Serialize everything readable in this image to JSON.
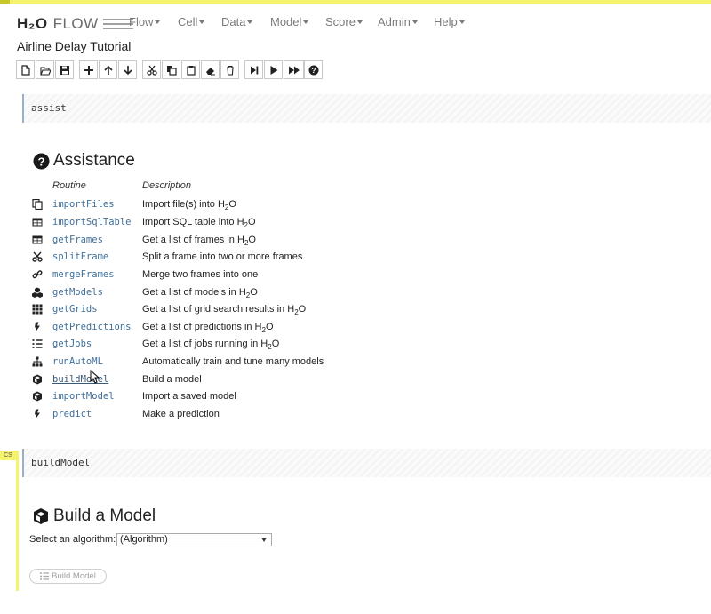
{
  "app": {
    "logo_text": "H₂O",
    "logo_flow": "FLOW",
    "menu": [
      "Flow",
      "Cell",
      "Data",
      "Model",
      "Score",
      "Admin",
      "Help"
    ],
    "notebook_title": "Airline Delay Tutorial"
  },
  "toolbar": {
    "buttons": [
      "new-file-icon",
      "open-folder-icon",
      "save-icon",
      "add-cell-icon",
      "move-up-icon",
      "move-down-icon",
      "cut-icon",
      "copy-icon",
      "paste-icon",
      "clear-output-icon",
      "delete-icon",
      "run-to-cursor-icon",
      "run-icon",
      "run-all-icon",
      "help-icon"
    ]
  },
  "cell1": {
    "input": "assist",
    "heading": "Assistance",
    "col_routine": "Routine",
    "col_description": "Description",
    "routines": [
      {
        "icon": "files-icon",
        "name": "importFiles",
        "desc_pre": "Import file(s) into H",
        "desc_sub": "2",
        "desc_post": "O"
      },
      {
        "icon": "table-icon",
        "name": "importSqlTable",
        "desc_pre": "Import SQL table into H",
        "desc_sub": "2",
        "desc_post": "O"
      },
      {
        "icon": "table-icon",
        "name": "getFrames",
        "desc_pre": "Get a list of frames in H",
        "desc_sub": "2",
        "desc_post": "O"
      },
      {
        "icon": "scissors-icon",
        "name": "splitFrame",
        "desc_pre": "Split a frame into two or more frames",
        "desc_sub": "",
        "desc_post": ""
      },
      {
        "icon": "link-icon",
        "name": "mergeFrames",
        "desc_pre": "Merge two frames into one",
        "desc_sub": "",
        "desc_post": ""
      },
      {
        "icon": "cubes-icon",
        "name": "getModels",
        "desc_pre": "Get a list of models in H",
        "desc_sub": "2",
        "desc_post": "O"
      },
      {
        "icon": "grid-icon",
        "name": "getGrids",
        "desc_pre": "Get a list of grid search results in H",
        "desc_sub": "2",
        "desc_post": "O"
      },
      {
        "icon": "bolt-icon",
        "name": "getPredictions",
        "desc_pre": "Get a list of predictions in H",
        "desc_sub": "2",
        "desc_post": "O"
      },
      {
        "icon": "tasks-icon",
        "name": "getJobs",
        "desc_pre": "Get a list of jobs running in H",
        "desc_sub": "2",
        "desc_post": "O"
      },
      {
        "icon": "sitemap-icon",
        "name": "runAutoML",
        "desc_pre": "Automatically train and tune many models",
        "desc_sub": "",
        "desc_post": ""
      },
      {
        "icon": "cube-icon",
        "name": "buildModel",
        "desc_pre": "Build a model",
        "desc_sub": "",
        "desc_post": ""
      },
      {
        "icon": "cube-icon",
        "name": "importModel",
        "desc_pre": "Import a saved model",
        "desc_sub": "",
        "desc_post": ""
      },
      {
        "icon": "bolt-icon",
        "name": "predict",
        "desc_pre": "Make a prediction",
        "desc_sub": "",
        "desc_post": ""
      }
    ]
  },
  "cell2": {
    "label": "CS",
    "input": "buildModel",
    "heading": "Build a Model",
    "select_label": "Select an algorithm:",
    "select_value": "(Algorithm)",
    "button_label": "Build Model"
  }
}
